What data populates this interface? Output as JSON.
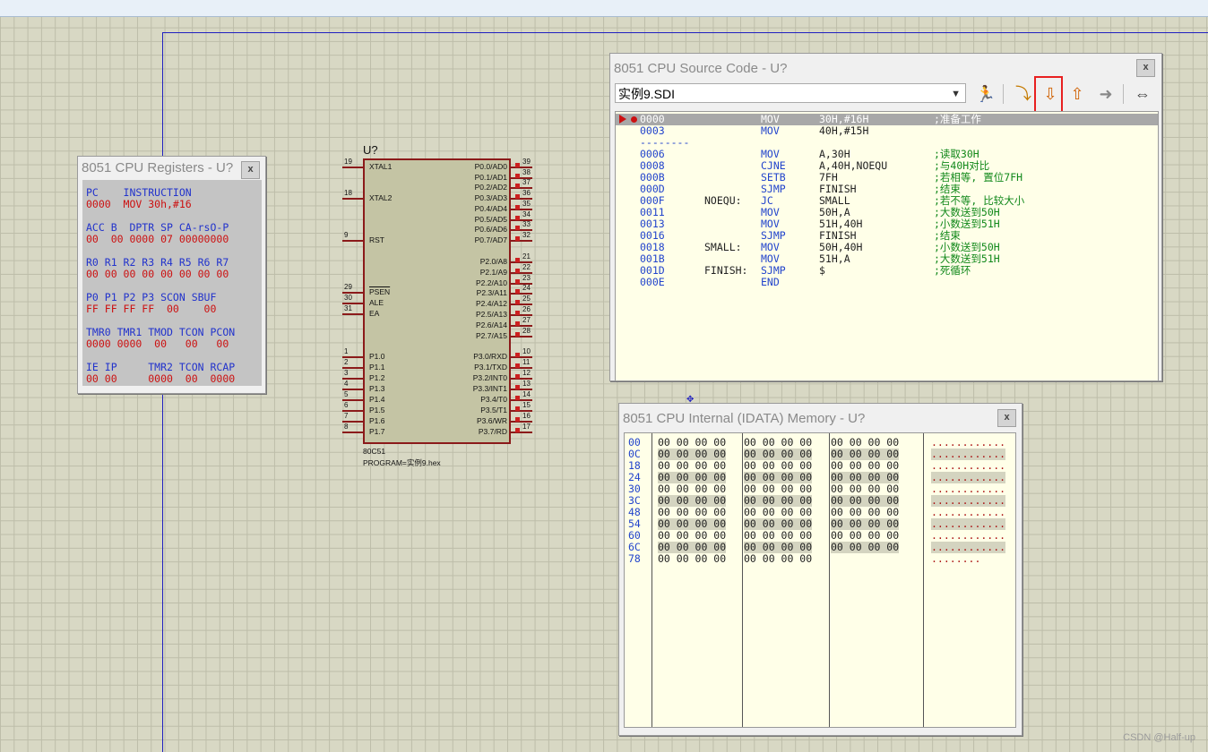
{
  "colors": {
    "background": "#d8d8c4",
    "grid": "#bdbda9",
    "register_head": "#2233cc",
    "register_value": "#cc1111",
    "chip_fill": "#c4c4a4",
    "chip_border": "#8b1a1a",
    "highlight": "#e82020"
  },
  "registers": {
    "title": "8051 CPU Registers - U?",
    "close": "x",
    "lines": [
      {
        "kind": "head",
        "text": "PC    INSTRUCTION"
      },
      {
        "kind": "val",
        "text": "0000  MOV 30h,#16"
      },
      {
        "kind": "head",
        "text": "ACC B  DPTR SP CA-rsO-P"
      },
      {
        "kind": "val",
        "text": "00  00 0000 07 00000000"
      },
      {
        "kind": "head",
        "text": "R0 R1 R2 R3 R4 R5 R6 R7"
      },
      {
        "kind": "val",
        "text": "00 00 00 00 00 00 00 00"
      },
      {
        "kind": "head",
        "text": "P0 P1 P2 P3 SCON SBUF"
      },
      {
        "kind": "val",
        "text": "FF FF FF FF  00    00"
      },
      {
        "kind": "head",
        "text": "TMR0 TMR1 TMOD TCON PCON"
      },
      {
        "kind": "val",
        "text": "0000 0000  00   00   00"
      },
      {
        "kind": "head",
        "text": "IE IP     TMR2 TCON RCAP"
      },
      {
        "kind": "val",
        "text": "00 00     0000  00  0000"
      }
    ]
  },
  "source": {
    "title": "8051 CPU Source Code - U?",
    "close": "x",
    "file": "实例9.SDI",
    "toolbar": [
      {
        "icon": "run-icon",
        "glyph": "🏃"
      },
      {
        "icon": "step-over-icon",
        "glyph": "⤵"
      },
      {
        "icon": "step-into-icon",
        "glyph": "⇩"
      },
      {
        "icon": "step-out-icon",
        "glyph": "⇧"
      },
      {
        "icon": "run-to-cursor-icon",
        "glyph": "➜"
      },
      {
        "icon": "toggle-breakpoint-icon",
        "glyph": "⇔"
      }
    ],
    "lines": [
      {
        "addr": "0000",
        "label": "",
        "mn": "MOV",
        "op": "30H,#16H",
        "cm": ";准备工作",
        "current": true
      },
      {
        "addr": "0003",
        "label": "",
        "mn": "MOV",
        "op": "40H,#15H",
        "cm": ""
      },
      {
        "addr": "--------",
        "label": "",
        "mn": "",
        "op": "",
        "cm": ""
      },
      {
        "addr": "0006",
        "label": "",
        "mn": "MOV",
        "op": "A,30H",
        "cm": ";读取30H"
      },
      {
        "addr": "0008",
        "label": "",
        "mn": "CJNE",
        "op": "A,40H,NOEQU",
        "cm": ";与40H对比"
      },
      {
        "addr": "000B",
        "label": "",
        "mn": "SETB",
        "op": "7FH",
        "cm": ";若相等, 置位7FH"
      },
      {
        "addr": "000D",
        "label": "",
        "mn": "SJMP",
        "op": "FINISH",
        "cm": ";结束"
      },
      {
        "addr": "000F",
        "label": "NOEQU:",
        "mn": "JC",
        "op": "SMALL",
        "cm": ";若不等, 比较大小"
      },
      {
        "addr": "0011",
        "label": "",
        "mn": "MOV",
        "op": "50H,A",
        "cm": ";大数送到50H"
      },
      {
        "addr": "0013",
        "label": "",
        "mn": "MOV",
        "op": "51H,40H",
        "cm": ";小数送到51H"
      },
      {
        "addr": "0016",
        "label": "",
        "mn": "SJMP",
        "op": "FINISH",
        "cm": ";结束"
      },
      {
        "addr": "0018",
        "label": "SMALL:",
        "mn": "MOV",
        "op": "50H,40H",
        "cm": ";小数送到50H"
      },
      {
        "addr": "001B",
        "label": "",
        "mn": "MOV",
        "op": "51H,A",
        "cm": ";大数送到51H"
      },
      {
        "addr": "001D",
        "label": "FINISH:",
        "mn": "SJMP",
        "op": "$",
        "cm": ";死循环"
      },
      {
        "addr": "000E",
        "label": "",
        "mn": "END",
        "op": "",
        "cm": ""
      }
    ]
  },
  "memory": {
    "title": "8051 CPU Internal (IDATA) Memory - U?",
    "close": "x",
    "rows": [
      {
        "addr": "00",
        "g1": "00 00 00 00",
        "g2": "00 00 00 00",
        "g3": "00 00 00 00",
        "ascii": "............"
      },
      {
        "addr": "0C",
        "g1": "00 00 00 00",
        "g2": "00 00 00 00",
        "g3": "00 00 00 00",
        "ascii": "............"
      },
      {
        "addr": "18",
        "g1": "00 00 00 00",
        "g2": "00 00 00 00",
        "g3": "00 00 00 00",
        "ascii": "............"
      },
      {
        "addr": "24",
        "g1": "00 00 00 00",
        "g2": "00 00 00 00",
        "g3": "00 00 00 00",
        "ascii": "............"
      },
      {
        "addr": "30",
        "g1": "00 00 00 00",
        "g2": "00 00 00 00",
        "g3": "00 00 00 00",
        "ascii": "............"
      },
      {
        "addr": "3C",
        "g1": "00 00 00 00",
        "g2": "00 00 00 00",
        "g3": "00 00 00 00",
        "ascii": "............"
      },
      {
        "addr": "48",
        "g1": "00 00 00 00",
        "g2": "00 00 00 00",
        "g3": "00 00 00 00",
        "ascii": "............"
      },
      {
        "addr": "54",
        "g1": "00 00 00 00",
        "g2": "00 00 00 00",
        "g3": "00 00 00 00",
        "ascii": "............"
      },
      {
        "addr": "60",
        "g1": "00 00 00 00",
        "g2": "00 00 00 00",
        "g3": "00 00 00 00",
        "ascii": "............"
      },
      {
        "addr": "6C",
        "g1": "00 00 00 00",
        "g2": "00 00 00 00",
        "g3": "00 00 00 00",
        "ascii": "............"
      },
      {
        "addr": "78",
        "g1": "00 00 00 00",
        "g2": "00 00 00 00",
        "g3": "",
        "ascii": "........"
      }
    ]
  },
  "chip": {
    "ref": "U?",
    "part": "80C51",
    "program": "PROGRAM=实例9.hex",
    "left_pins": [
      {
        "num": "19",
        "label": "XTAL1"
      },
      {
        "num": "18",
        "label": "XTAL2"
      },
      {
        "num": "9",
        "label": "RST"
      },
      {
        "num": "29",
        "label": "PSEN"
      },
      {
        "num": "30",
        "label": "ALE"
      },
      {
        "num": "31",
        "label": "EA"
      },
      {
        "num": "1",
        "label": "P1.0"
      },
      {
        "num": "2",
        "label": "P1.1"
      },
      {
        "num": "3",
        "label": "P1.2"
      },
      {
        "num": "4",
        "label": "P1.3"
      },
      {
        "num": "5",
        "label": "P1.4"
      },
      {
        "num": "6",
        "label": "P1.5"
      },
      {
        "num": "7",
        "label": "P1.6"
      },
      {
        "num": "8",
        "label": "P1.7"
      }
    ],
    "right_pins": [
      {
        "num": "39",
        "label": "P0.0/AD0"
      },
      {
        "num": "38",
        "label": "P0.1/AD1"
      },
      {
        "num": "37",
        "label": "P0.2/AD2"
      },
      {
        "num": "36",
        "label": "P0.3/AD3"
      },
      {
        "num": "35",
        "label": "P0.4/AD4"
      },
      {
        "num": "34",
        "label": "P0.5/AD5"
      },
      {
        "num": "33",
        "label": "P0.6/AD6"
      },
      {
        "num": "32",
        "label": "P0.7/AD7"
      },
      {
        "num": "21",
        "label": "P2.0/A8"
      },
      {
        "num": "22",
        "label": "P2.1/A9"
      },
      {
        "num": "23",
        "label": "P2.2/A10"
      },
      {
        "num": "24",
        "label": "P2.3/A11"
      },
      {
        "num": "25",
        "label": "P2.4/A12"
      },
      {
        "num": "26",
        "label": "P2.5/A13"
      },
      {
        "num": "27",
        "label": "P2.6/A14"
      },
      {
        "num": "28",
        "label": "P2.7/A15"
      },
      {
        "num": "10",
        "label": "P3.0/RXD"
      },
      {
        "num": "11",
        "label": "P3.1/TXD"
      },
      {
        "num": "12",
        "label": "P3.2/INT0"
      },
      {
        "num": "13",
        "label": "P3.3/INT1"
      },
      {
        "num": "14",
        "label": "P3.4/T0"
      },
      {
        "num": "15",
        "label": "P3.5/T1"
      },
      {
        "num": "16",
        "label": "P3.6/WR"
      },
      {
        "num": "17",
        "label": "P3.7/RD"
      }
    ]
  },
  "watermark": "CSDN @Half-up"
}
